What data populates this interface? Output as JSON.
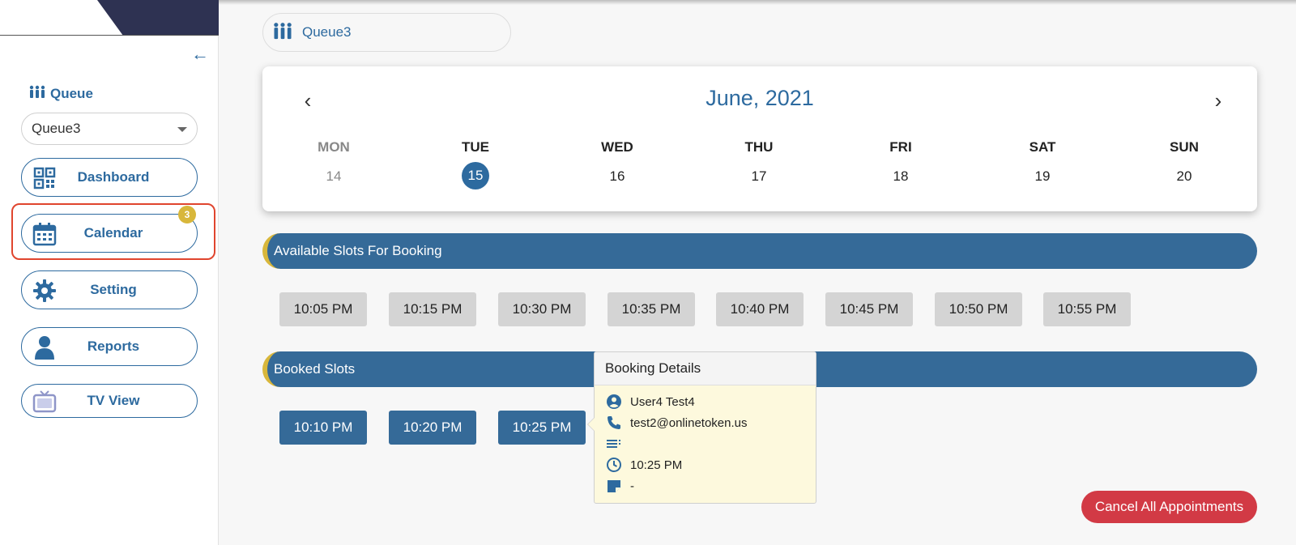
{
  "sidebar": {
    "queue_label": "Queue",
    "queue_select_value": "Queue3",
    "nav": [
      {
        "label": "Dashboard",
        "icon": "qr-code-icon"
      },
      {
        "label": "Calendar",
        "icon": "calendar-icon",
        "badge": "3"
      },
      {
        "label": "Setting",
        "icon": "gear-icon"
      },
      {
        "label": "Reports",
        "icon": "user-icon"
      },
      {
        "label": "TV View",
        "icon": "tv-icon"
      }
    ]
  },
  "main": {
    "queue_chip": "Queue3",
    "calendar": {
      "title": "June, 2021",
      "days": [
        {
          "name": "MON",
          "num": "14"
        },
        {
          "name": "TUE",
          "num": "15"
        },
        {
          "name": "WED",
          "num": "16"
        },
        {
          "name": "THU",
          "num": "17"
        },
        {
          "name": "FRI",
          "num": "18"
        },
        {
          "name": "SAT",
          "num": "19"
        },
        {
          "name": "SUN",
          "num": "20"
        }
      ]
    },
    "available_title": "Available Slots For Booking",
    "available_slots": [
      "10:05 PM",
      "10:15 PM",
      "10:30 PM",
      "10:35 PM",
      "10:40 PM",
      "10:45 PM",
      "10:50 PM",
      "10:55 PM"
    ],
    "booked_title": "Booked Slots",
    "booked_slots": [
      "10:10 PM",
      "10:20 PM",
      "10:25 PM"
    ],
    "booking_details": {
      "title": "Booking Details",
      "name": "User4 Test4",
      "contact": "test2@onlinetoken.us",
      "notes": "",
      "time": "10:25 PM",
      "memo": "-"
    },
    "cancel_all_label": "Cancel All Appointments"
  },
  "colors": {
    "primary": "#2d6a9f",
    "section_bar": "#356a98",
    "accent": "#d8b73b",
    "danger": "#d23a45",
    "highlight": "#e0452e"
  }
}
